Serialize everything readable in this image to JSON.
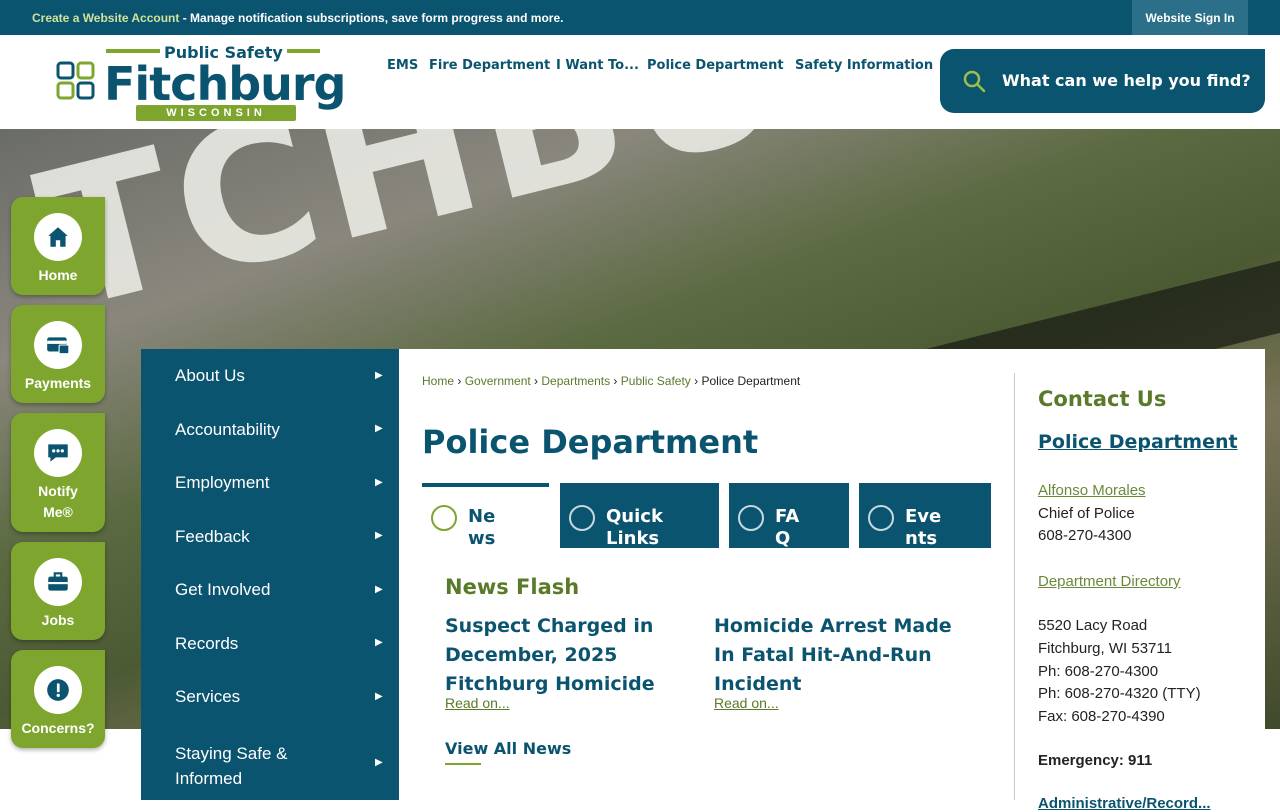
{
  "topbar": {
    "create_link": "Create a Website Account",
    "create_desc": " - Manage notification subscriptions, save form progress and more.",
    "sign_in": "Website Sign In"
  },
  "logo": {
    "top": "Public Safety",
    "city": "Fitchburg",
    "state": "WISCONSIN"
  },
  "nav": [
    "EMS",
    "Fire Department",
    "I Want To...",
    "Police Department",
    "Safety Information"
  ],
  "search": {
    "placeholder": "What can we help you find?",
    "icon": "search-icon"
  },
  "hero": {
    "text": "TCHBURG"
  },
  "quick_links": [
    {
      "label": "Home",
      "icon": "home-icon"
    },
    {
      "label": "Payments",
      "icon": "payment-card-icon"
    },
    {
      "label": "Notify Me®",
      "icon": "chat-bubble-icon"
    },
    {
      "label": "Jobs",
      "icon": "briefcase-icon"
    },
    {
      "label": "Concerns?",
      "icon": "alert-icon"
    }
  ],
  "side_menu": [
    "About Us",
    "Accountability",
    "Employment",
    "Feedback",
    "Get Involved",
    "Records",
    "Services",
    "Staying Safe & Informed"
  ],
  "breadcrumb": {
    "items": [
      "Home",
      "Government",
      "Departments",
      "Public Safety"
    ],
    "current": "Police Department"
  },
  "page_title": "Police Department",
  "tabs": [
    {
      "label": "Ne ws",
      "active": true
    },
    {
      "label": "Quick Links",
      "active": false
    },
    {
      "label": "FA Q",
      "active": false
    },
    {
      "label": "Eve nts",
      "active": false
    }
  ],
  "news": {
    "heading": "News Flash",
    "articles": [
      {
        "title": "Suspect Charged in December, 2025 Fitchburg Homicide",
        "more": "Read on..."
      },
      {
        "title": "Homicide Arrest Made In Fatal Hit-And-Run Incident",
        "more": "Read on..."
      }
    ],
    "view_all": "View All News"
  },
  "contact": {
    "heading": "Contact Us",
    "department": "Police Department",
    "chief_name": "Alfonso Morales",
    "chief_title": "Chief of Police",
    "chief_phone": "608-270-4300",
    "directory": "Department Directory",
    "address1": "5520 Lacy Road",
    "address2": "Fitchburg, WI 53711",
    "phone": "Ph: 608-270-4300",
    "tty": "Ph: 608-270-4320 (TTY)",
    "fax": "Fax: 608-270-4390",
    "emergency": "Emergency: 911",
    "admin_partial": "Administrative/Record..."
  },
  "colors": {
    "primary": "#0b5470",
    "accent": "#7ea62e",
    "green_text": "#5a7a2a"
  }
}
